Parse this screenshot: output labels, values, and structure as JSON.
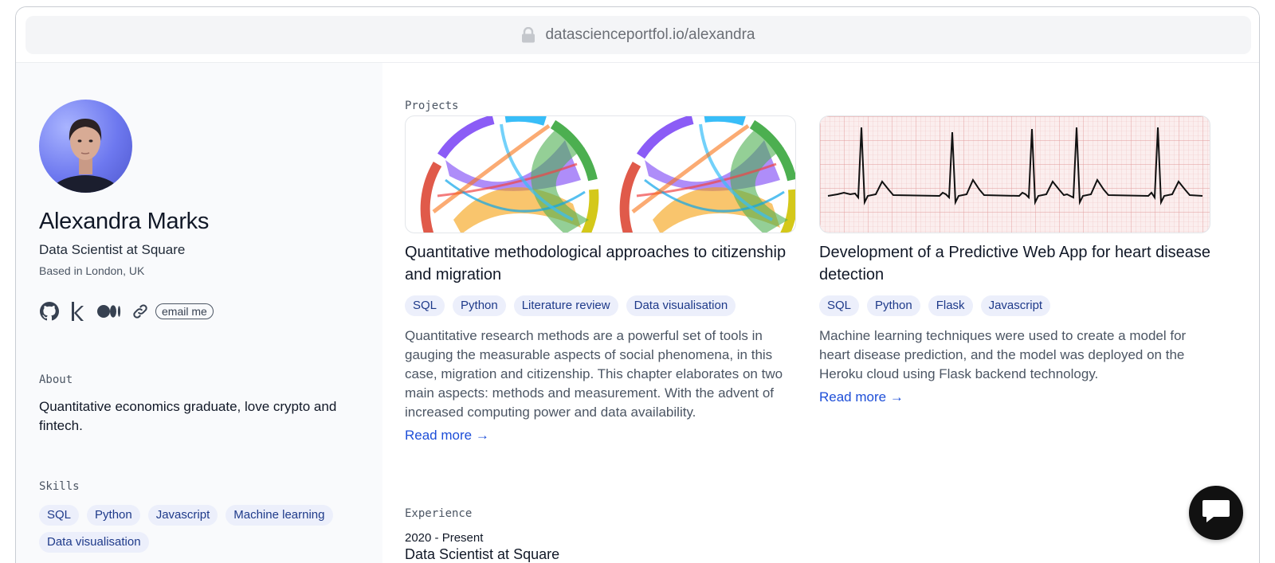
{
  "browser": {
    "url": "datascienceportfol.io/alexandra",
    "icon": "lock-icon"
  },
  "profile": {
    "name": "Alexandra Marks",
    "role": "Data Scientist at Square",
    "location": "Based in London, UK",
    "socials": [
      "github-icon",
      "kaggle-icon",
      "medium-icon",
      "link-icon"
    ],
    "email_label": "email me"
  },
  "about": {
    "label": "About",
    "text": "Quantitative economics graduate, love crypto and fintech."
  },
  "skills": {
    "label": "Skills",
    "items": [
      "SQL",
      "Python",
      "Javascript",
      "Machine learning",
      "Data visualisation"
    ]
  },
  "projects": {
    "label": "Projects",
    "items": [
      {
        "title": "Quantitative methodological approaches to citizenship and migration",
        "tags": [
          "SQL",
          "Python",
          "Literature review",
          "Data visualisation"
        ],
        "description": "Quantitative research methods are a powerful set of tools in gauging the measurable aspects of social phenomena, in this case, migration and citizenship. This chapter elaborates on two main aspects: methods and measurement. With the advent of increased computing power and data availability.",
        "read_more": "Read more →",
        "image": "chord-diagram-image"
      },
      {
        "title": "Development of a Predictive Web App for heart disease detection",
        "tags": [
          "SQL",
          "Python",
          "Flask",
          "Javascript"
        ],
        "description": "Machine learning techniques were used to create a model for heart disease prediction, and the model was deployed on the Heroku cloud using Flask backend technology.",
        "read_more": "Read more →",
        "image": "ecg-image"
      }
    ]
  },
  "experience": {
    "label": "Experience",
    "items": [
      {
        "date": "2020 - Present",
        "title": "Data Scientist at Square"
      }
    ]
  },
  "chat": {
    "icon": "chat-icon"
  },
  "colors": {
    "accent": "#1d4ed8",
    "tag_bg": "#eceffb",
    "tag_text": "#1e3a8a",
    "sidebar_bg": "#f9fafc"
  }
}
